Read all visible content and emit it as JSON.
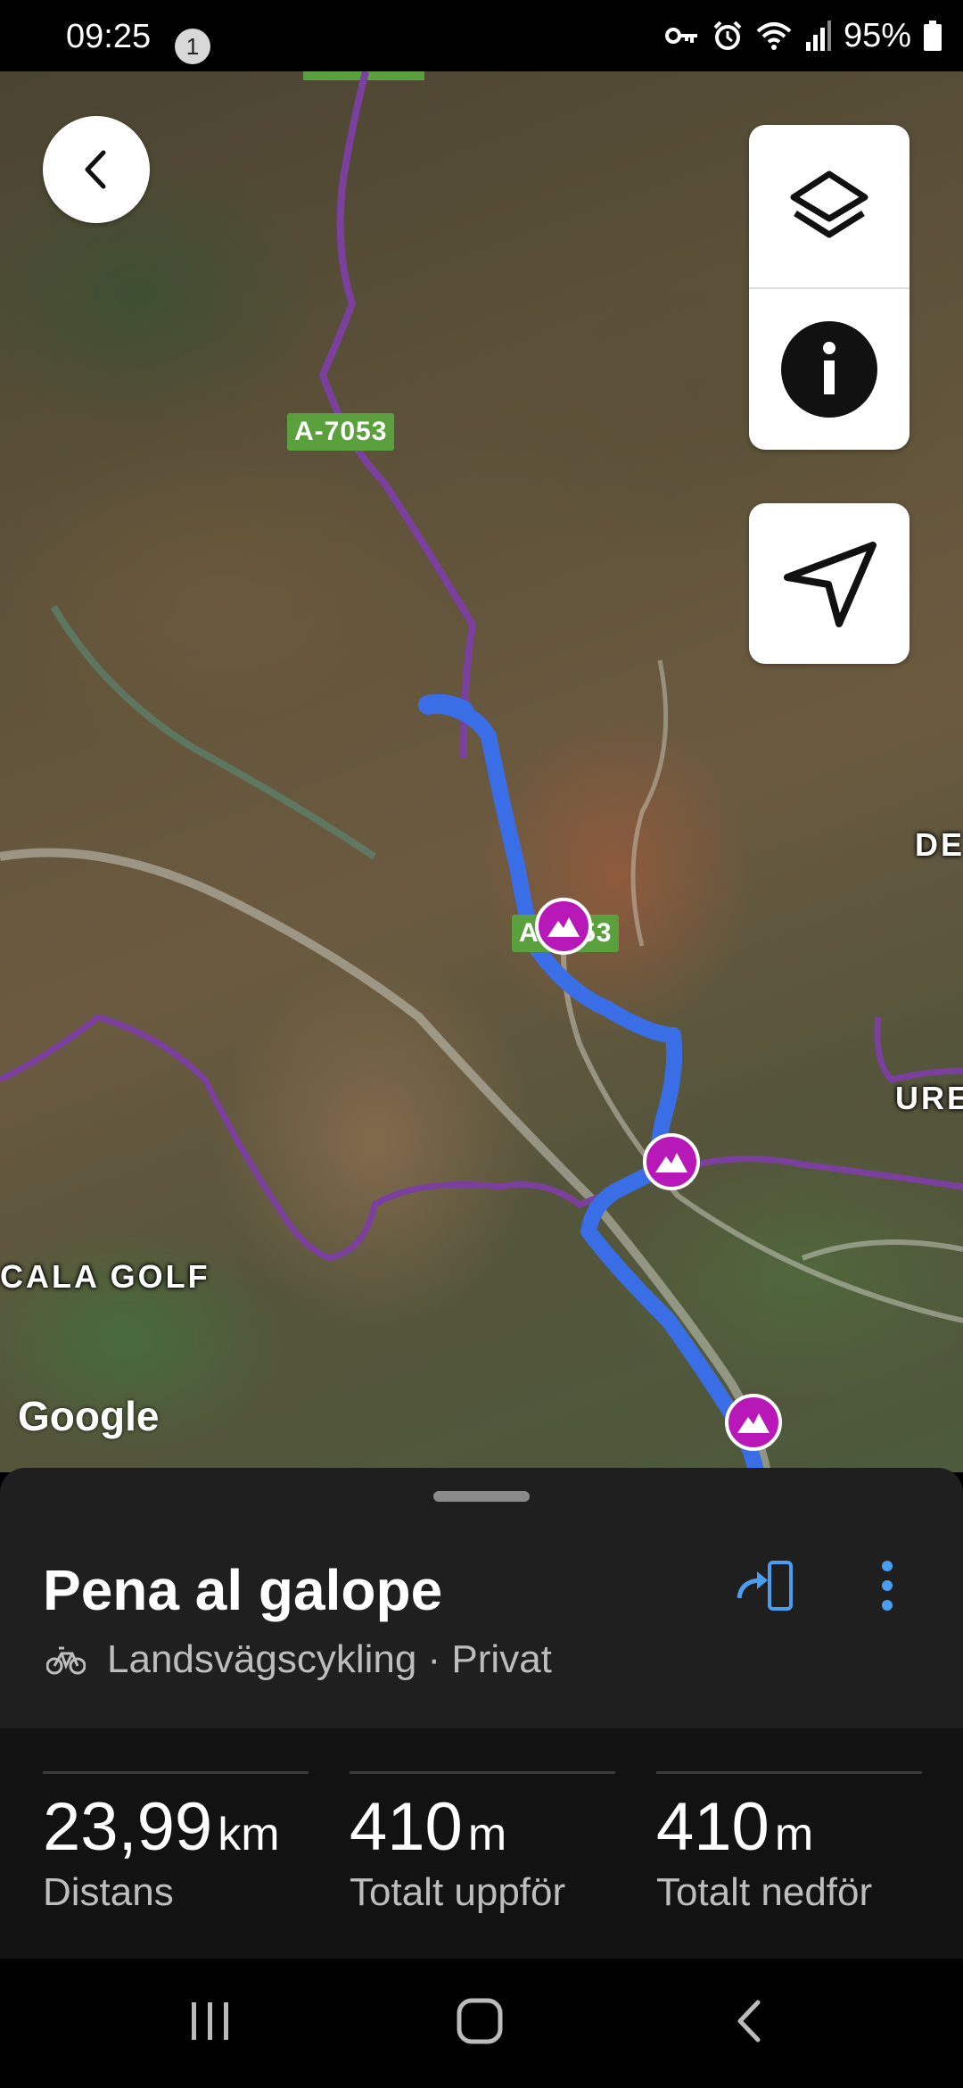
{
  "status_bar": {
    "time": "09:25",
    "notification_count": "1",
    "battery": "95%",
    "icons": [
      "vpn-key-icon",
      "alarm-icon",
      "wifi-icon",
      "signal-icon",
      "battery-icon"
    ]
  },
  "map": {
    "road_labels": [
      "A-7053",
      "A-7053"
    ],
    "place_labels": [
      "DE",
      "URE",
      "CALA GOLF"
    ],
    "attribution": "Google",
    "colors": {
      "route": "#3a6ee6",
      "trail": "#7b3f9e",
      "peak_marker": "#b818b8",
      "road_label_bg": "#5aa03c"
    }
  },
  "controls": {
    "back": "back-icon",
    "layers": "layers-icon",
    "info": "info-icon",
    "locate": "navigation-arrow-icon"
  },
  "route": {
    "title": "Pena al galope",
    "activity": "Landsvägscykling · Privat",
    "activity_icon": "bicycle-icon",
    "accent_color": "#4a9df0"
  },
  "stats": [
    {
      "value": "23,99",
      "unit": "km",
      "label": "Distans"
    },
    {
      "value": "410",
      "unit": "m",
      "label": "Totalt uppför"
    },
    {
      "value": "410",
      "unit": "m",
      "label": "Totalt nedför"
    }
  ],
  "nav_bar": [
    "recents-icon",
    "home-icon",
    "back-nav-icon"
  ]
}
